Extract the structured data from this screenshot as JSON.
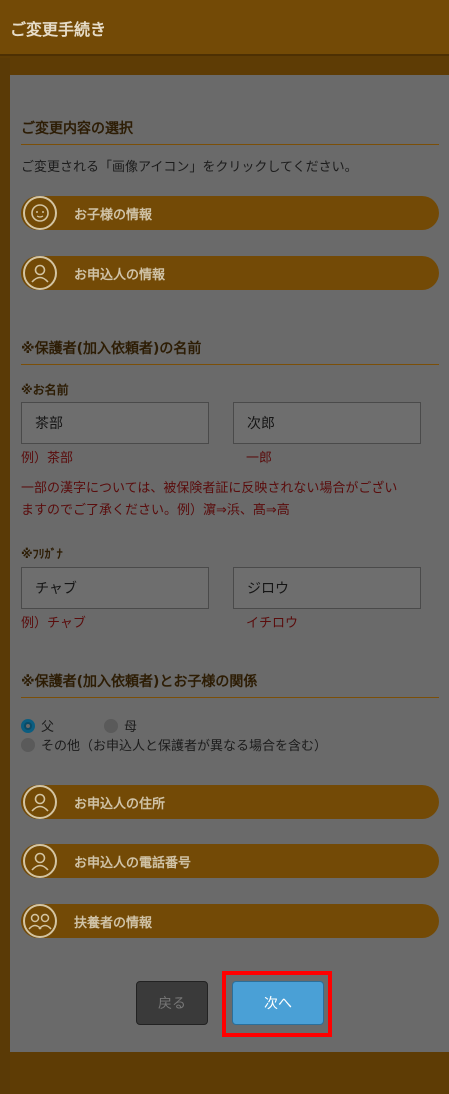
{
  "header": {
    "title": "ご変更手続き"
  },
  "section1": {
    "title": "ご変更内容の選択",
    "instruction": "ご変更される「画像アイコン」をクリックしてください。",
    "items": [
      {
        "label": "お子様の情報",
        "icon": "baby-icon"
      },
      {
        "label": "お申込人の情報",
        "icon": "person-icon"
      }
    ]
  },
  "section2": {
    "title": "※保護者(加入依頼者)の名前",
    "name_label": "※お名前",
    "last_name_value": "茶部",
    "first_name_value": "次郎",
    "last_name_example": "例）茶部",
    "first_name_example": "一郎",
    "kanji_note_line1": "一部の漢字については、被保険者証に反映されない場合がござい",
    "kanji_note_line2": "ますのでご了承ください。例）濵⇒浜、髙⇒高",
    "furigana_label": "※ﾌﾘｶﾞﾅ",
    "last_kana_value": "チャブ",
    "first_kana_value": "ジロウ",
    "last_kana_example": "例）チャブ",
    "first_kana_example": "イチロウ"
  },
  "section3": {
    "title": "※保護者(加入依頼者)とお子様の関係",
    "options": [
      {
        "label": "父",
        "selected": true
      },
      {
        "label": "母",
        "selected": false
      },
      {
        "label": "その他（お申込人と保護者が異なる場合を含む）",
        "selected": false
      }
    ]
  },
  "more_items": [
    {
      "label": "お申込人の住所",
      "icon": "person-icon"
    },
    {
      "label": "お申込人の電話番号",
      "icon": "person-icon"
    },
    {
      "label": "扶養者の情報",
      "icon": "family-icon"
    }
  ],
  "buttons": {
    "back": "戻る",
    "next": "次へ"
  },
  "colors": {
    "header": "#734a06",
    "pill": "#734a06",
    "next_button": "#4aa0d6",
    "highlight": "#ff0000"
  }
}
